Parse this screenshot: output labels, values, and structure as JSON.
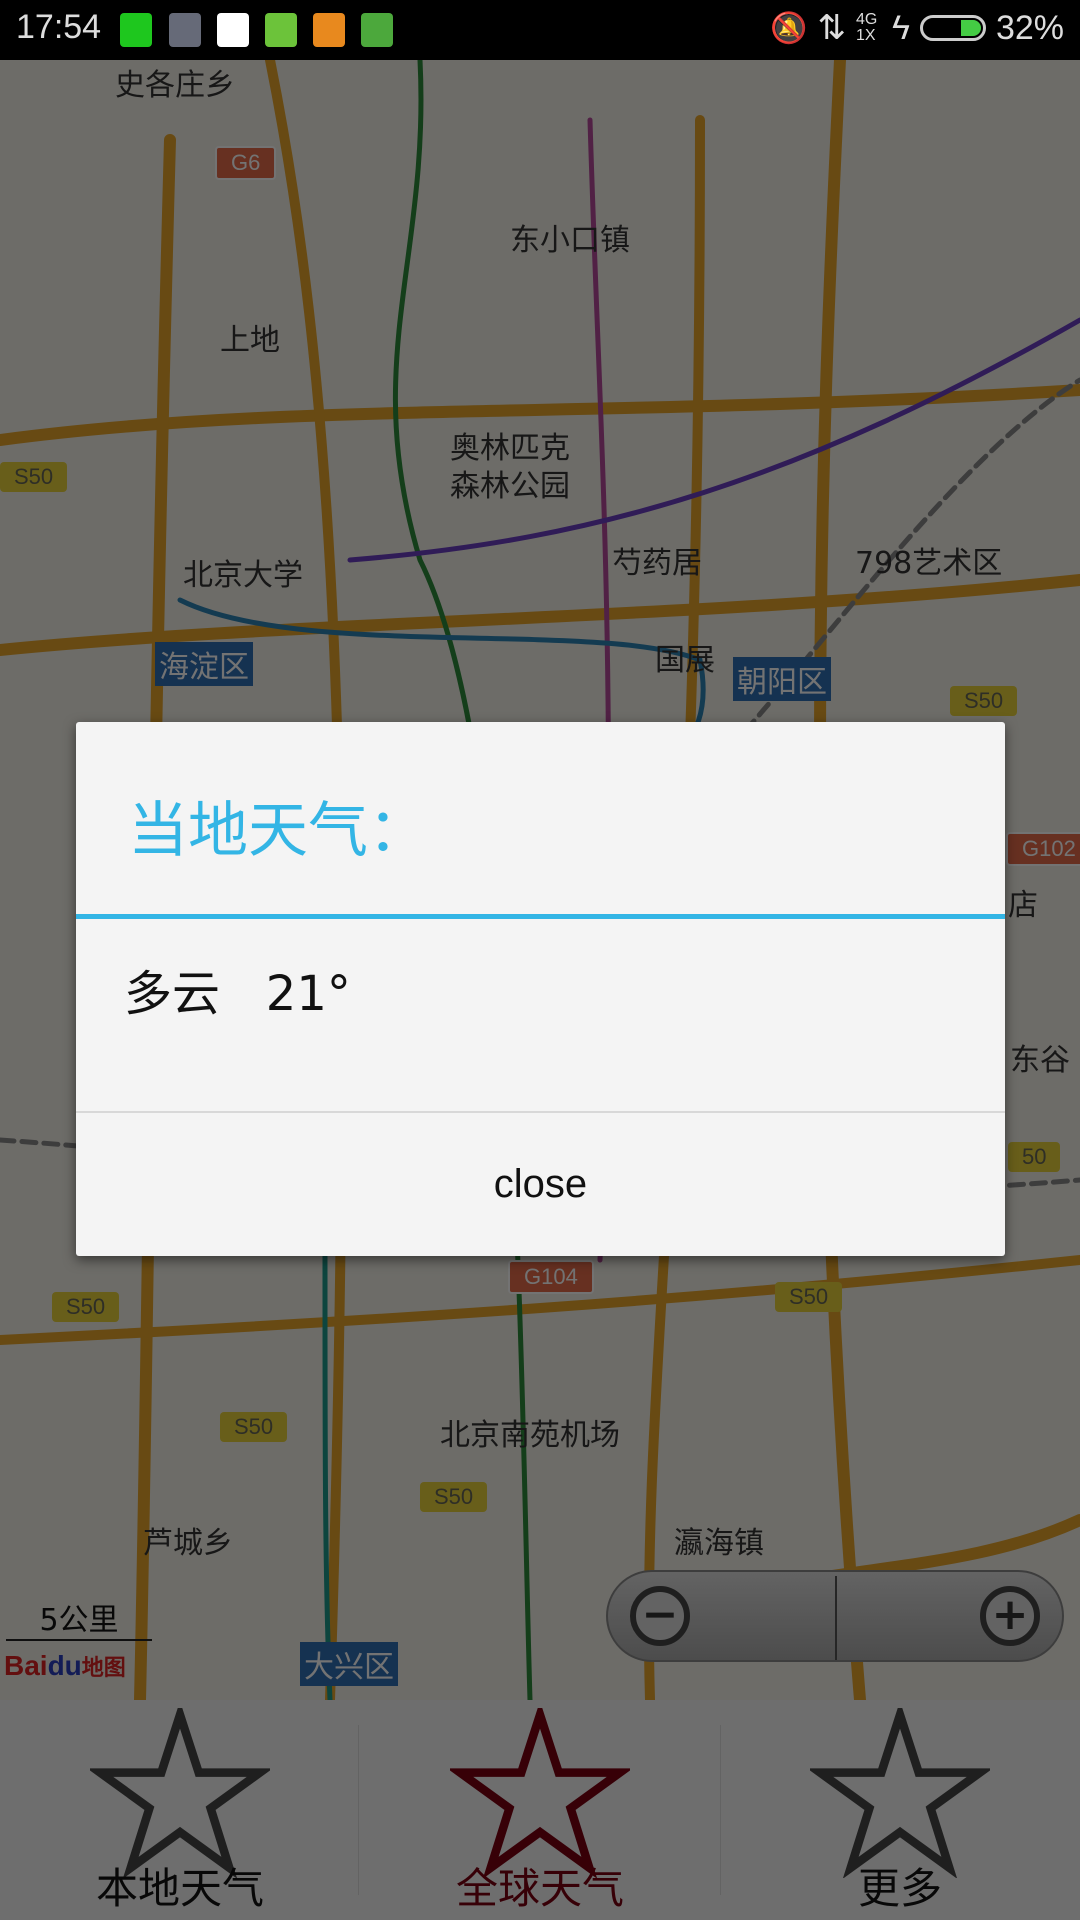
{
  "status_bar": {
    "time": "17:54",
    "battery": "32%",
    "network": "4G 1X",
    "notification_icons": [
      "wechat-icon",
      "scissors-icon",
      "qq-icon",
      "phone-icon",
      "brush-icon",
      "android-icon"
    ]
  },
  "map": {
    "labels": [
      "史各庄乡",
      "东小口镇",
      "上地",
      "奥林匹克\n森林公园",
      "北京大学",
      "芍药居",
      "798艺术区",
      "国展",
      "店",
      "东谷",
      "北京南苑机场",
      "芦城乡",
      "瀛海镇"
    ],
    "districts": [
      "海淀区",
      "朝阳区",
      "大兴区"
    ],
    "shields": [
      "G6",
      "S50",
      "S50",
      "G102",
      "S50",
      "G104",
      "S50",
      "S50",
      "S50",
      "50"
    ],
    "scale": "5公里",
    "logo": "Baidu地图"
  },
  "dialog": {
    "title": "当地天气：",
    "message": "多云   21°",
    "close": "close",
    "accent": "#33b5e5"
  },
  "nav": {
    "tabs": [
      {
        "label": "本地天气",
        "active": false
      },
      {
        "label": "全球天气",
        "active": true
      },
      {
        "label": "更多",
        "active": false
      }
    ],
    "active_color": "#7a0010"
  }
}
